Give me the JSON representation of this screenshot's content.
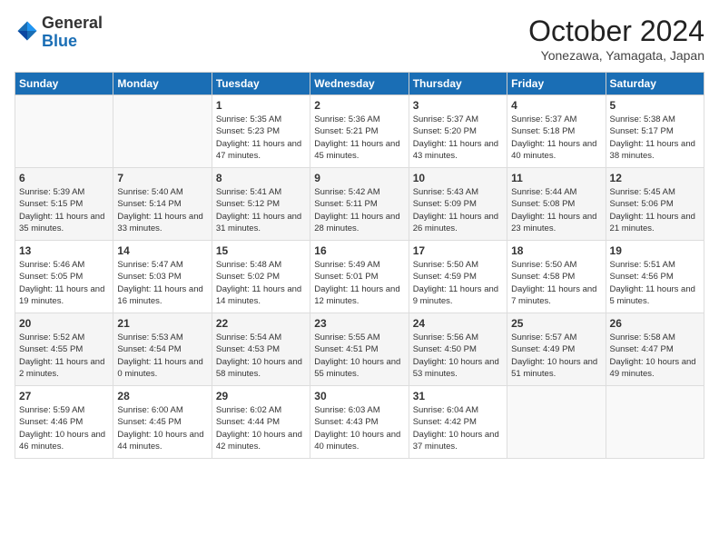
{
  "header": {
    "logo_general": "General",
    "logo_blue": "Blue",
    "month_year": "October 2024",
    "location": "Yonezawa, Yamagata, Japan"
  },
  "days_of_week": [
    "Sunday",
    "Monday",
    "Tuesday",
    "Wednesday",
    "Thursday",
    "Friday",
    "Saturday"
  ],
  "weeks": [
    [
      {
        "day": "",
        "info": ""
      },
      {
        "day": "",
        "info": ""
      },
      {
        "day": "1",
        "info": "Sunrise: 5:35 AM\nSunset: 5:23 PM\nDaylight: 11 hours and 47 minutes."
      },
      {
        "day": "2",
        "info": "Sunrise: 5:36 AM\nSunset: 5:21 PM\nDaylight: 11 hours and 45 minutes."
      },
      {
        "day": "3",
        "info": "Sunrise: 5:37 AM\nSunset: 5:20 PM\nDaylight: 11 hours and 43 minutes."
      },
      {
        "day": "4",
        "info": "Sunrise: 5:37 AM\nSunset: 5:18 PM\nDaylight: 11 hours and 40 minutes."
      },
      {
        "day": "5",
        "info": "Sunrise: 5:38 AM\nSunset: 5:17 PM\nDaylight: 11 hours and 38 minutes."
      }
    ],
    [
      {
        "day": "6",
        "info": "Sunrise: 5:39 AM\nSunset: 5:15 PM\nDaylight: 11 hours and 35 minutes."
      },
      {
        "day": "7",
        "info": "Sunrise: 5:40 AM\nSunset: 5:14 PM\nDaylight: 11 hours and 33 minutes."
      },
      {
        "day": "8",
        "info": "Sunrise: 5:41 AM\nSunset: 5:12 PM\nDaylight: 11 hours and 31 minutes."
      },
      {
        "day": "9",
        "info": "Sunrise: 5:42 AM\nSunset: 5:11 PM\nDaylight: 11 hours and 28 minutes."
      },
      {
        "day": "10",
        "info": "Sunrise: 5:43 AM\nSunset: 5:09 PM\nDaylight: 11 hours and 26 minutes."
      },
      {
        "day": "11",
        "info": "Sunrise: 5:44 AM\nSunset: 5:08 PM\nDaylight: 11 hours and 23 minutes."
      },
      {
        "day": "12",
        "info": "Sunrise: 5:45 AM\nSunset: 5:06 PM\nDaylight: 11 hours and 21 minutes."
      }
    ],
    [
      {
        "day": "13",
        "info": "Sunrise: 5:46 AM\nSunset: 5:05 PM\nDaylight: 11 hours and 19 minutes."
      },
      {
        "day": "14",
        "info": "Sunrise: 5:47 AM\nSunset: 5:03 PM\nDaylight: 11 hours and 16 minutes."
      },
      {
        "day": "15",
        "info": "Sunrise: 5:48 AM\nSunset: 5:02 PM\nDaylight: 11 hours and 14 minutes."
      },
      {
        "day": "16",
        "info": "Sunrise: 5:49 AM\nSunset: 5:01 PM\nDaylight: 11 hours and 12 minutes."
      },
      {
        "day": "17",
        "info": "Sunrise: 5:50 AM\nSunset: 4:59 PM\nDaylight: 11 hours and 9 minutes."
      },
      {
        "day": "18",
        "info": "Sunrise: 5:50 AM\nSunset: 4:58 PM\nDaylight: 11 hours and 7 minutes."
      },
      {
        "day": "19",
        "info": "Sunrise: 5:51 AM\nSunset: 4:56 PM\nDaylight: 11 hours and 5 minutes."
      }
    ],
    [
      {
        "day": "20",
        "info": "Sunrise: 5:52 AM\nSunset: 4:55 PM\nDaylight: 11 hours and 2 minutes."
      },
      {
        "day": "21",
        "info": "Sunrise: 5:53 AM\nSunset: 4:54 PM\nDaylight: 11 hours and 0 minutes."
      },
      {
        "day": "22",
        "info": "Sunrise: 5:54 AM\nSunset: 4:53 PM\nDaylight: 10 hours and 58 minutes."
      },
      {
        "day": "23",
        "info": "Sunrise: 5:55 AM\nSunset: 4:51 PM\nDaylight: 10 hours and 55 minutes."
      },
      {
        "day": "24",
        "info": "Sunrise: 5:56 AM\nSunset: 4:50 PM\nDaylight: 10 hours and 53 minutes."
      },
      {
        "day": "25",
        "info": "Sunrise: 5:57 AM\nSunset: 4:49 PM\nDaylight: 10 hours and 51 minutes."
      },
      {
        "day": "26",
        "info": "Sunrise: 5:58 AM\nSunset: 4:47 PM\nDaylight: 10 hours and 49 minutes."
      }
    ],
    [
      {
        "day": "27",
        "info": "Sunrise: 5:59 AM\nSunset: 4:46 PM\nDaylight: 10 hours and 46 minutes."
      },
      {
        "day": "28",
        "info": "Sunrise: 6:00 AM\nSunset: 4:45 PM\nDaylight: 10 hours and 44 minutes."
      },
      {
        "day": "29",
        "info": "Sunrise: 6:02 AM\nSunset: 4:44 PM\nDaylight: 10 hours and 42 minutes."
      },
      {
        "day": "30",
        "info": "Sunrise: 6:03 AM\nSunset: 4:43 PM\nDaylight: 10 hours and 40 minutes."
      },
      {
        "day": "31",
        "info": "Sunrise: 6:04 AM\nSunset: 4:42 PM\nDaylight: 10 hours and 37 minutes."
      },
      {
        "day": "",
        "info": ""
      },
      {
        "day": "",
        "info": ""
      }
    ]
  ]
}
